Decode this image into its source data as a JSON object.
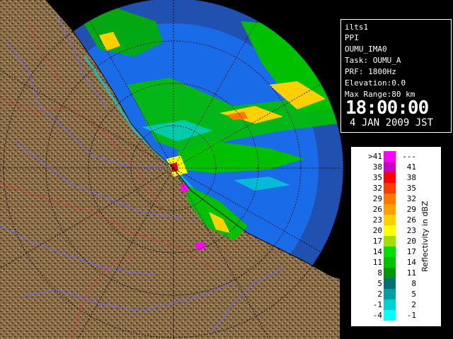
{
  "info": {
    "station": "ilts1",
    "product": "PPI",
    "volume": "OUMU_IMA0",
    "task": "Task: OUMU_A",
    "prf": "PRF: 1800Hz",
    "elevation": "Elevation:0.0",
    "max_range": "Max Range:80 km",
    "time": "18:00:00",
    "date": "4 JAN 2009 JST"
  },
  "legend": {
    "unit_label": "Reflectivity in dBZ",
    "rows": [
      {
        "low": ">41",
        "high": "---",
        "color": "#ff00ff"
      },
      {
        "low": "38",
        "high": "41",
        "color": "#c800c8"
      },
      {
        "low": "35",
        "high": "38",
        "color": "#ff0000"
      },
      {
        "low": "32",
        "high": "35",
        "color": "#ff3c00"
      },
      {
        "low": "29",
        "high": "32",
        "color": "#ff7800"
      },
      {
        "low": "26",
        "high": "29",
        "color": "#ffa000"
      },
      {
        "low": "23",
        "high": "26",
        "color": "#ffd000"
      },
      {
        "low": "20",
        "high": "23",
        "color": "#ffff00"
      },
      {
        "low": "17",
        "high": "20",
        "color": "#a0e000"
      },
      {
        "low": "14",
        "high": "17",
        "color": "#00e000"
      },
      {
        "low": "11",
        "high": "14",
        "color": "#00c000"
      },
      {
        "low": "8",
        "high": "11",
        "color": "#009600"
      },
      {
        "low": "5",
        "high": "8",
        "color": "#007070"
      },
      {
        "low": "2",
        "high": "5",
        "color": "#00a0a0"
      },
      {
        "low": "-1",
        "high": "2",
        "color": "#00d0d0"
      },
      {
        "low": "-4",
        "high": "-1",
        "color": "#00ffff"
      }
    ]
  },
  "colors": {
    "sea_echo_free": "#1a6be8",
    "out_of_range": "#2050b0",
    "land": "#8a6e48",
    "land_dark": "#5a4128",
    "rivers": "#6a6af0",
    "boundaries": "#d04040"
  }
}
